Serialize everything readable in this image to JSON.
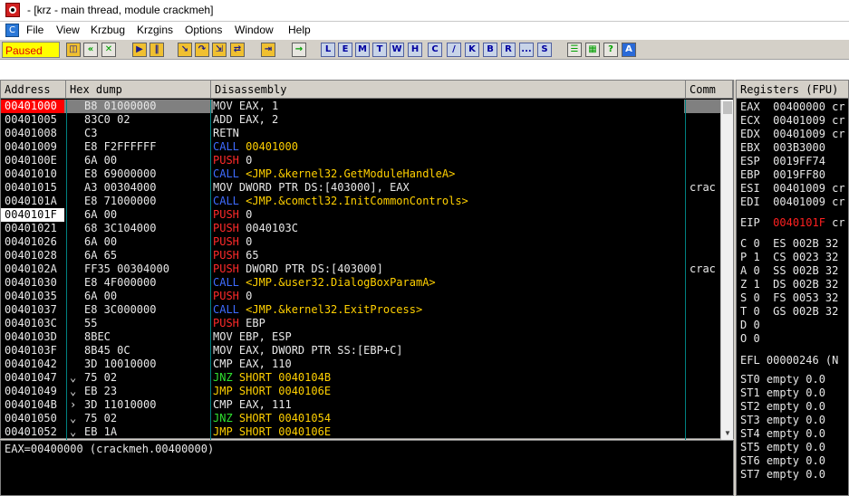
{
  "window": {
    "title": "- [krz - main thread, module crackmeh]"
  },
  "menu": [
    "File",
    "View",
    "Krzbug",
    "Krzgins",
    "Options",
    "Window",
    "Help"
  ],
  "toolbar": {
    "status": "Paused",
    "letters": [
      "L",
      "E",
      "M",
      "T",
      "W",
      "H",
      "C",
      "/",
      "K",
      "B",
      "R",
      "...",
      "S"
    ]
  },
  "columns": {
    "address": "Address",
    "hex": "Hex dump",
    "disasm": "Disassembly",
    "comment": "Comm"
  },
  "colors": {
    "call": "#3e6bff",
    "push": "#ff2a2a",
    "jump": "#ffd000",
    "operand_yellow": "#ffd000",
    "reg_changed": "#ff2020",
    "selected_addr": "#ff0000"
  },
  "rows": [
    {
      "addr": "00401000",
      "hex": "B8 01000000",
      "ins": "MOV EAX, 1",
      "kind": "plain",
      "com": ""
    },
    {
      "addr": "00401005",
      "hex": "83C0 02",
      "ins": "ADD EAX, 2",
      "kind": "plain",
      "com": ""
    },
    {
      "addr": "00401008",
      "hex": "C3",
      "ins": "RETN",
      "kind": "plain",
      "com": ""
    },
    {
      "addr": "00401009",
      "hex": "E8 F2FFFFFF",
      "mn": "CALL",
      "op": "00401000",
      "kind": "call",
      "com": ""
    },
    {
      "addr": "0040100E",
      "hex": "6A 00",
      "mn": "PUSH",
      "op": "0",
      "kind": "push",
      "com": ""
    },
    {
      "addr": "00401010",
      "hex": "E8 69000000",
      "mn": "CALL",
      "op": "<JMP.&kernel32.GetModuleHandleA>",
      "kind": "call",
      "com": ""
    },
    {
      "addr": "00401015",
      "hex": "A3 00304000",
      "ins": "MOV DWORD PTR DS:[403000], EAX",
      "kind": "plain",
      "com": "crac"
    },
    {
      "addr": "0040101A",
      "hex": "E8 71000000",
      "mn": "CALL",
      "op": "<JMP.&comctl32.InitCommonControls>",
      "kind": "call",
      "com": ""
    },
    {
      "addr": "0040101F",
      "hex": "6A 00",
      "mn": "PUSH",
      "op": "0",
      "kind": "push",
      "com": ""
    },
    {
      "addr": "00401021",
      "hex": "68 3C104000",
      "mn": "PUSH",
      "op": "0040103C",
      "kind": "push",
      "com": ""
    },
    {
      "addr": "00401026",
      "hex": "6A 00",
      "mn": "PUSH",
      "op": "0",
      "kind": "push",
      "com": ""
    },
    {
      "addr": "00401028",
      "hex": "6A 65",
      "mn": "PUSH",
      "op": "65",
      "kind": "push",
      "com": ""
    },
    {
      "addr": "0040102A",
      "hex": "FF35 00304000",
      "mn": "PUSH",
      "op": "DWORD PTR DS:[403000]",
      "kind": "push",
      "com": "crac"
    },
    {
      "addr": "00401030",
      "hex": "E8 4F000000",
      "mn": "CALL",
      "op": "<JMP.&user32.DialogBoxParamA>",
      "kind": "call",
      "com": ""
    },
    {
      "addr": "00401035",
      "hex": "6A 00",
      "mn": "PUSH",
      "op": "0",
      "kind": "push",
      "com": ""
    },
    {
      "addr": "00401037",
      "hex": "E8 3C000000",
      "mn": "CALL",
      "op": "<JMP.&kernel32.ExitProcess>",
      "kind": "call",
      "com": ""
    },
    {
      "addr": "0040103C",
      "hex": "55",
      "mn": "PUSH",
      "op": "EBP",
      "kind": "push",
      "com": ""
    },
    {
      "addr": "0040103D",
      "hex": "8BEC",
      "ins": "MOV EBP, ESP",
      "kind": "plain",
      "com": ""
    },
    {
      "addr": "0040103F",
      "hex": "8B45 0C",
      "ins": "MOV EAX, DWORD PTR SS:[EBP+C]",
      "kind": "plain",
      "com": ""
    },
    {
      "addr": "00401042",
      "hex": "3D 10010000",
      "ins": "CMP EAX, 110",
      "kind": "plain",
      "com": ""
    },
    {
      "addr": "00401047",
      "hex": "75 02",
      "mn": "JNZ",
      "op": "SHORT 0040104B",
      "kind": "jcc",
      "com": "",
      "jmark": "v"
    },
    {
      "addr": "00401049",
      "hex": "EB 23",
      "mn": "JMP",
      "op": "SHORT 0040106E",
      "kind": "jmp",
      "com": "",
      "jmark": "v"
    },
    {
      "addr": "0040104B",
      "hex": "3D 11010000",
      "ins": "CMP EAX, 111",
      "kind": "plain",
      "com": "",
      "jmark": ">"
    },
    {
      "addr": "00401050",
      "hex": "75 02",
      "mn": "JNZ",
      "op": "SHORT 00401054",
      "kind": "jcc",
      "com": "",
      "jmark": "v"
    },
    {
      "addr": "00401052",
      "hex": "EB 1A",
      "mn": "JMP",
      "op": "SHORT 0040106E",
      "kind": "jmp",
      "com": "",
      "jmark": "v"
    }
  ],
  "info": "EAX=00400000 (crackmeh.00400000)",
  "registers": {
    "header": "Registers (FPU)",
    "gp": [
      {
        "name": "EAX",
        "val": "00400000 cr"
      },
      {
        "name": "ECX",
        "val": "00401009 cr"
      },
      {
        "name": "EDX",
        "val": "00401009 cr"
      },
      {
        "name": "EBX",
        "val": "003B3000"
      },
      {
        "name": "ESP",
        "val": "0019FF74"
      },
      {
        "name": "EBP",
        "val": "0019FF80"
      },
      {
        "name": "ESI",
        "val": "00401009 cr"
      },
      {
        "name": "EDI",
        "val": "00401009 cr"
      }
    ],
    "eip": {
      "name": "EIP",
      "val": "0040101F",
      "tail": "cr"
    },
    "flags": [
      "C 0  ES 002B 32",
      "P 1  CS 0023 32",
      "A 0  SS 002B 32",
      "Z 1  DS 002B 32",
      "S 0  FS 0053 32",
      "T 0  GS 002B 32",
      "D 0",
      "O 0"
    ],
    "efl": "EFL 00000246 (N",
    "st": [
      "ST0 empty 0.0",
      "ST1 empty 0.0",
      "ST2 empty 0.0",
      "ST3 empty 0.0",
      "ST4 empty 0.0",
      "ST5 empty 0.0",
      "ST6 empty 0.0",
      "ST7 empty 0.0"
    ]
  }
}
